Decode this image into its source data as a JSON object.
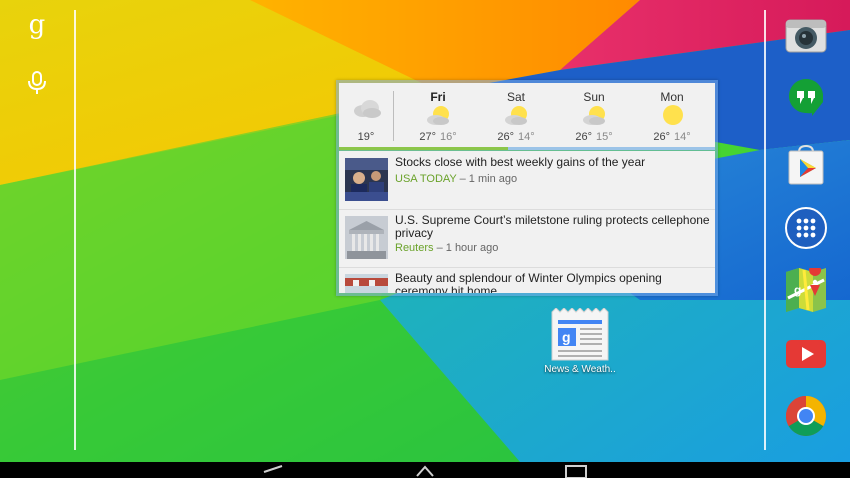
{
  "search": {
    "g_label": "g"
  },
  "weather": {
    "current": {
      "temp": "19°"
    },
    "days": [
      {
        "name": "Fri",
        "high": "27°",
        "low": "16°",
        "icon": "partly-cloudy-icon"
      },
      {
        "name": "Sat",
        "high": "26°",
        "low": "14°",
        "icon": "partly-cloudy-icon"
      },
      {
        "name": "Sun",
        "high": "26°",
        "low": "15°",
        "icon": "partly-cloudy-icon"
      },
      {
        "name": "Mon",
        "high": "26°",
        "low": "14°",
        "icon": "sunny-icon"
      }
    ]
  },
  "news": {
    "stories": [
      {
        "headline": "Stocks close with best weekly gains of the year",
        "source": "USA TODAY",
        "time": "– 1 min ago"
      },
      {
        "headline": "U.S. Supreme Court’s miletstone ruling protects cellephone privacy",
        "source": "Reuters",
        "time": "– 1 hour ago"
      },
      {
        "headline": "Beauty and splendour of Winter Olympics opening ceremony hit home",
        "source": "",
        "time": ""
      }
    ]
  },
  "desktop": {
    "news_app_label": "News & Weath.."
  },
  "dock": [
    "camera-icon",
    "hangouts-icon",
    "play-store-icon",
    "app-drawer-icon",
    "maps-icon",
    "youtube-icon",
    "chrome-icon"
  ],
  "colors": {
    "source_green": "#6aa22a",
    "widget_bg": "#f1f1f1"
  }
}
